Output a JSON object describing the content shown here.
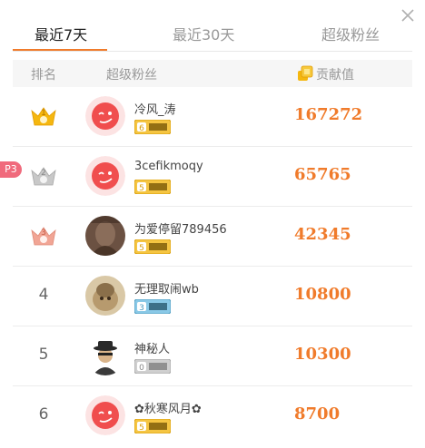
{
  "tabs": [
    {
      "label": "最近7天",
      "active": true
    },
    {
      "label": "最近30天",
      "active": false
    },
    {
      "label": "超级粉丝",
      "active": false
    }
  ],
  "table": {
    "headers": {
      "rank": "排名",
      "fan": "超级粉丝",
      "contribution": "贡献值"
    },
    "rows": [
      {
        "rank": "1",
        "name": "冷风_涛",
        "badge_level": "6",
        "value": "167272",
        "avatar": "weibo-red-logo"
      },
      {
        "rank": "2",
        "name": "3cefikmoqy",
        "badge_level": "5",
        "value": "65765",
        "avatar": "weibo-red-logo"
      },
      {
        "rank": "3",
        "name": "为爱停留789456",
        "badge_level": "5",
        "value": "42345",
        "avatar": "photo-brown"
      },
      {
        "rank": "4",
        "name": "无理取闹wb",
        "badge_level": "3",
        "value": "10800",
        "avatar": "photo-cat"
      },
      {
        "rank": "5",
        "name": "神秘人",
        "badge_level": "0",
        "value": "10300",
        "avatar": "mystery-man"
      },
      {
        "rank": "6",
        "name": "✿秋寒风月✿",
        "badge_level": "5",
        "value": "8700",
        "avatar": "weibo-red-logo"
      }
    ]
  },
  "side_tag": "P3",
  "colors": {
    "accent": "#f07b2b",
    "gold": "#f5b70f",
    "silver": "#bdbdbd",
    "bronze": "#f1a595",
    "badge_gold": "#f5c542",
    "badge_blue": "#8ac9e7",
    "badge_gray": "#bdbdbd"
  }
}
